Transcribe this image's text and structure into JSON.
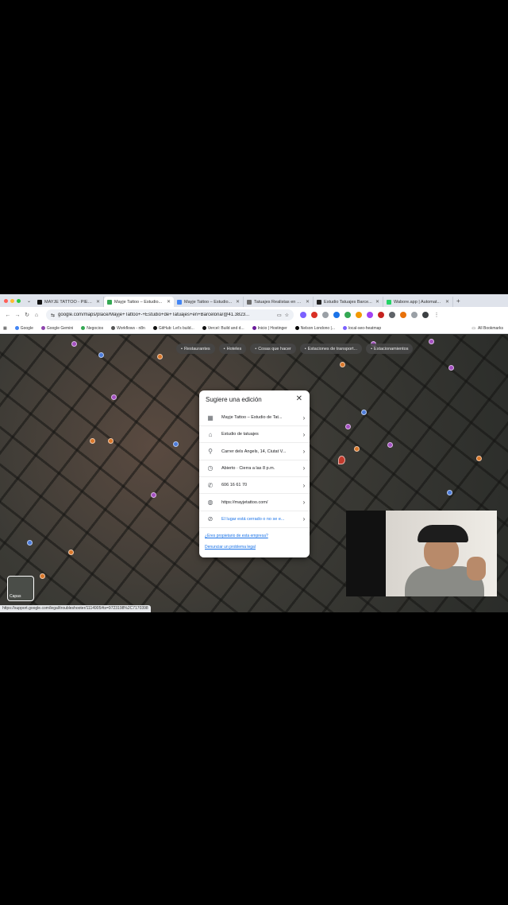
{
  "browser": {
    "tabs": [
      {
        "title": "MAYJE TATTOO - PIERCI...",
        "color": "#111111"
      },
      {
        "title": "Mayje Tattoo – Estudio...",
        "color": "#34a853",
        "active": true
      },
      {
        "title": "Mayje Tattoo – Estudio...",
        "color": "#4285f4"
      },
      {
        "title": "Tatuajes Realistas en B...",
        "color": "#6c6c6c"
      },
      {
        "title": "Estudio Tatuajes Barce...",
        "color": "#222222"
      },
      {
        "title": "Wabore.app | Automat...",
        "color": "#25d366"
      }
    ],
    "url": "google.com/maps/place/Mayje+Tattoo+-+Estudio+de+Tatuajes+en+Barcelona/@41.3823...",
    "bookmarks": [
      "Google",
      "Google Gemini",
      "Negocios",
      "Workflows - n8n",
      "GitHub: Let's build...",
      "Vercel: Build and d...",
      "Inicio | Hostinger",
      "Nelson Londono |...",
      "local-seo-heatmap"
    ],
    "all_bookmarks": "All Bookmarks"
  },
  "map": {
    "chips": [
      "Restaurantes",
      "Hoteles",
      "Cosas que hacer",
      "Estaciones de transport...",
      "Estacionamientos"
    ],
    "layers_label": "Capas"
  },
  "dialog": {
    "title": "Sugiere una edición",
    "rows": [
      {
        "icon": "store-icon",
        "glyph": "▦",
        "text": "Mayje Tattoo – Estudio de Tat..."
      },
      {
        "icon": "category-icon",
        "glyph": "⌂",
        "text": "Estudio de tatuajes"
      },
      {
        "icon": "location-pin-icon",
        "glyph": "⚲",
        "text": "Carrer dels Àngels, 14, Ciutat V..."
      },
      {
        "icon": "clock-icon",
        "glyph": "◷",
        "text": "Abierto · Cierra a las 8 p.m."
      },
      {
        "icon": "phone-icon",
        "glyph": "✆",
        "text": "606 16 61 70"
      },
      {
        "icon": "globe-icon",
        "glyph": "◍",
        "text": "https://mayjetattoo.com/"
      },
      {
        "icon": "closed-place-icon",
        "glyph": "⊘",
        "text": "El lugar está cerrado o no se e...",
        "highlight": true
      }
    ],
    "owner_link": "¿Eres propietario de esta empresa?",
    "report_link": "Denunciar un problema legal"
  },
  "status_url": "https://support.google.com/legal/troubleshooter/1114905#ts=9723198%2C7170398"
}
